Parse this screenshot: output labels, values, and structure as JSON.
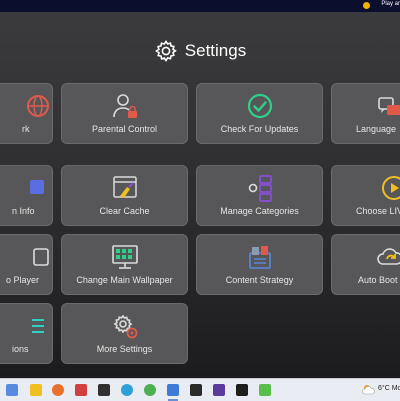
{
  "topbar": {
    "label": "Play ar"
  },
  "header": {
    "title": "Settings"
  },
  "tiles": [
    {
      "label": "rk"
    },
    {
      "label": "Parental Control"
    },
    {
      "label": "Check For Updates"
    },
    {
      "label": "Language"
    },
    {
      "label": "n Info"
    },
    {
      "label": "Clear Cache"
    },
    {
      "label": "Manage Categories"
    },
    {
      "label": "Choose LIV"
    },
    {
      "label": "o Player"
    },
    {
      "label": "Change Main Wallpaper"
    },
    {
      "label": "Content Strategy"
    },
    {
      "label": "Auto Boot"
    },
    {
      "label": "ions"
    },
    {
      "label": "More Settings"
    }
  ],
  "taskbar": {
    "temperature": "6°C",
    "weather_label": "Mo",
    "apps": [
      "start",
      "search",
      "file-explorer",
      "firefox",
      "media",
      "terminal",
      "edge",
      "android",
      "store",
      "game",
      "app-p",
      "app-c"
    ]
  },
  "colors": {
    "tile_bg": "#575759",
    "accent_red": "#e05a4a",
    "accent_green": "#2fd08a",
    "accent_purple": "#8a4fd6",
    "accent_yellow": "#f0c020"
  }
}
